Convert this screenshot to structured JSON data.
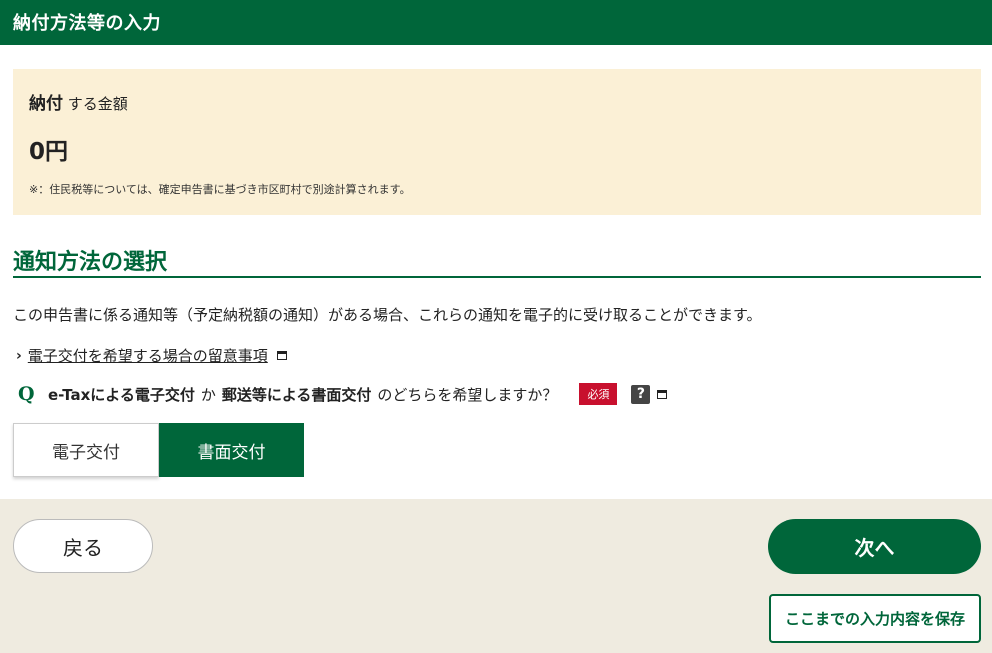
{
  "header": {
    "title": "納付方法等の入力"
  },
  "payment": {
    "label_strong": "納付",
    "label_rest": "する金額",
    "amount": "0円",
    "note": "※：住民税等については、確定申告書に基づき市区町村で別途計算されます。"
  },
  "notification": {
    "title": "通知方法の選択",
    "description": "この申告書に係る通知等（予定納税額の通知）がある場合、これらの通知を電子的に受け取ることができます。",
    "link_text": "電子交付を希望する場合の留意事項",
    "question": {
      "q_mark": "Q",
      "part1": "e-Taxによる電子交付",
      "part2": "か",
      "part3": "郵送等による書面交付",
      "part4": "のどちらを希望しますか？",
      "required": "必須",
      "help": "?"
    },
    "options": [
      {
        "label": "電子交付",
        "selected": false
      },
      {
        "label": "書面交付",
        "selected": true
      }
    ]
  },
  "footer": {
    "back_label": "戻る",
    "next_label": "次へ",
    "save_label": "ここまでの入力内容を保存"
  },
  "colors": {
    "brand_green": "#00663a",
    "amount_bg": "#fbf0d6",
    "required_red": "#c8102e",
    "footer_bg": "#efebe0"
  },
  "icons": {
    "link_chevron": "chevron-right-icon",
    "new_window": "new-window-icon",
    "help": "help-icon"
  }
}
